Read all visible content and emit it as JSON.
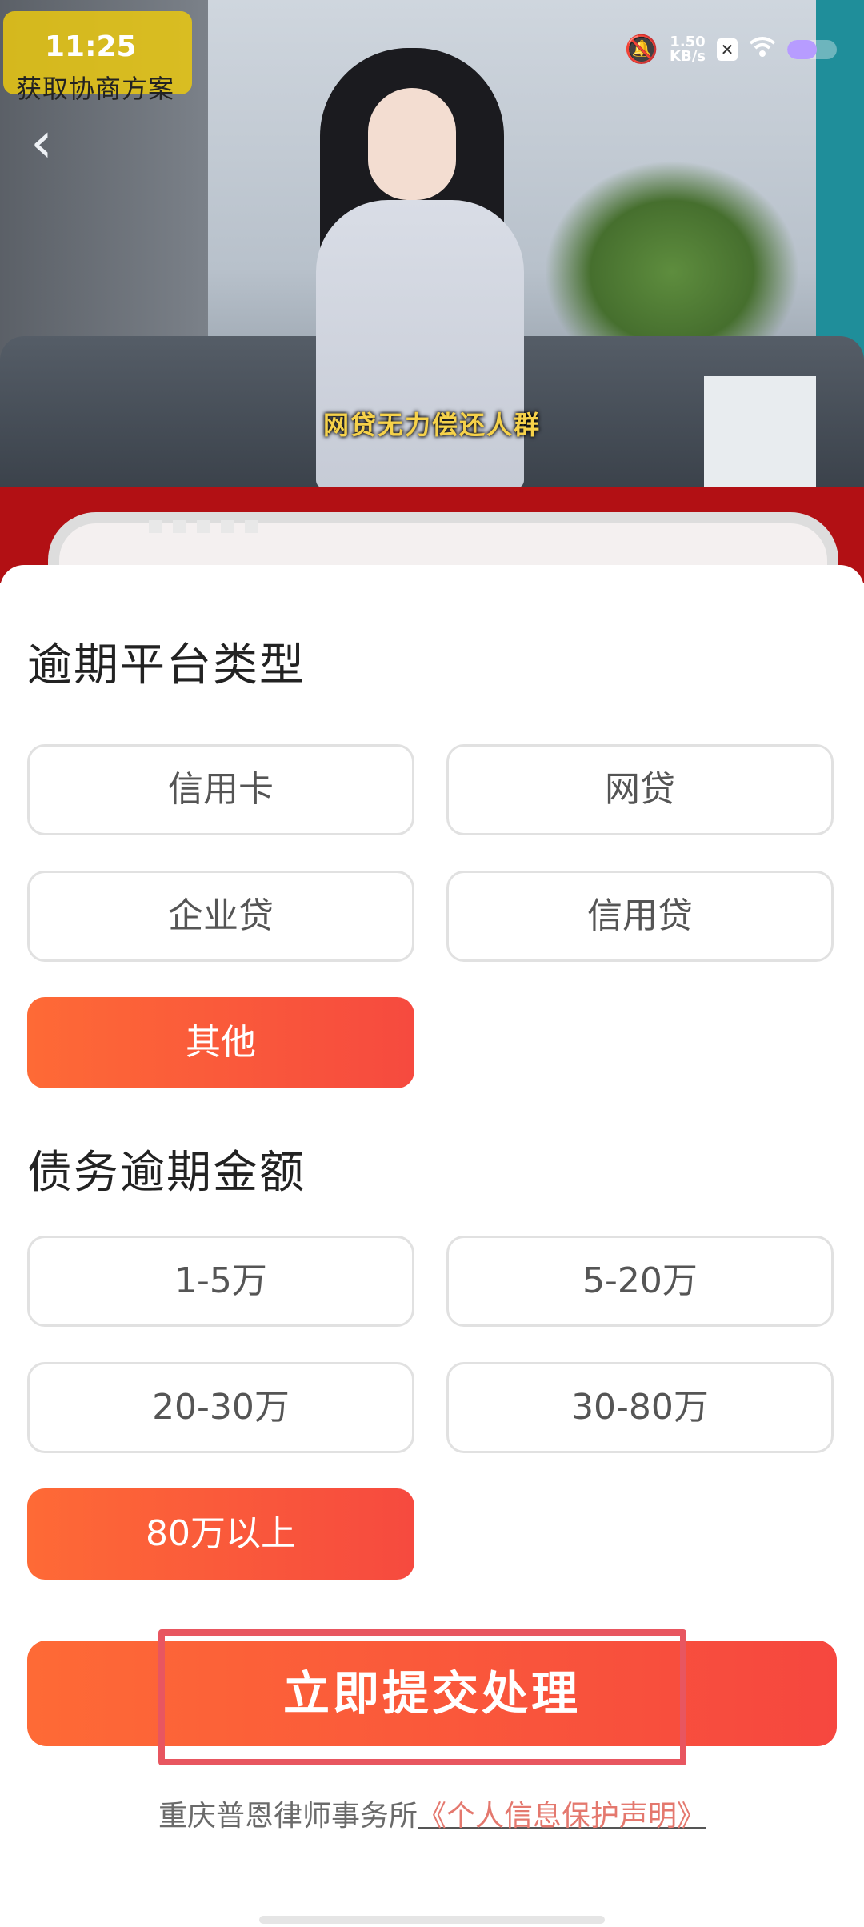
{
  "status_bar": {
    "time": "11:25",
    "net_speed_value": "1.50",
    "net_speed_unit": "KB/s",
    "battery_level": 0.6,
    "icons": [
      "mute-bell-icon",
      "x-app-icon",
      "wifi-icon",
      "battery-icon"
    ]
  },
  "video": {
    "hint": "获取协商方案",
    "subtitle": "网贷无力偿还人群"
  },
  "section_platform": {
    "title": "逾期平台类型",
    "options": [
      "信用卡",
      "网贷",
      "企业贷",
      "信用贷",
      "其他"
    ],
    "selected": "其他"
  },
  "section_amount": {
    "title": "债务逾期金额",
    "options": [
      "1-5万",
      "5-20万",
      "20-30万",
      "30-80万",
      "80万以上"
    ],
    "selected": "80万以上"
  },
  "submit_label": "立即提交处理",
  "footer": {
    "firm": "重庆普恩律师事务所",
    "policy_link": "《个人信息保护声明》"
  },
  "colors": {
    "accent_start": "#fe6a36",
    "accent_end": "#f64a3f",
    "highlight": "#e85660",
    "link": "#e4786e"
  }
}
